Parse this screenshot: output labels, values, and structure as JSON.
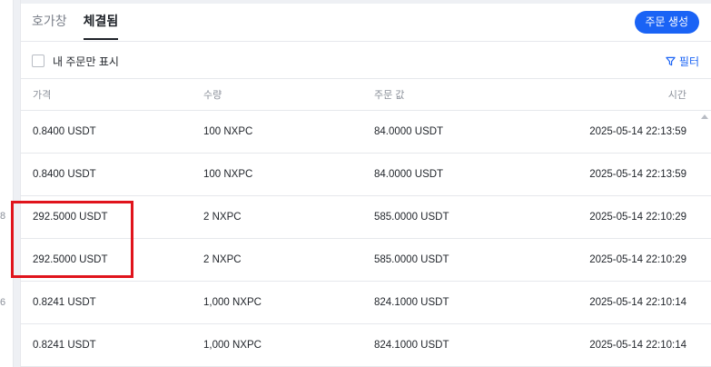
{
  "left_strip": {
    "ghost_numbers": [
      "8",
      "6"
    ]
  },
  "tabs": [
    {
      "label": "호가창",
      "active": false
    },
    {
      "label": "체결됨",
      "active": true
    }
  ],
  "create_order_label": "주문 생성",
  "filter_row": {
    "my_orders_label": "내 주문만 표시",
    "my_orders_checked": false,
    "filter_label": "필터"
  },
  "table": {
    "headers": {
      "price": "가격",
      "quantity": "수량",
      "order_value": "주문 값",
      "time": "시간"
    },
    "rows": [
      {
        "price": "0.8400 USDT",
        "quantity": "100 NXPC",
        "order_value": "84.0000 USDT",
        "time": "2025-05-14 22:13:59"
      },
      {
        "price": "0.8400 USDT",
        "quantity": "100 NXPC",
        "order_value": "84.0000 USDT",
        "time": "2025-05-14 22:13:59"
      },
      {
        "price": "292.5000 USDT",
        "quantity": "2 NXPC",
        "order_value": "585.0000 USDT",
        "time": "2025-05-14 22:10:29"
      },
      {
        "price": "292.5000 USDT",
        "quantity": "2 NXPC",
        "order_value": "585.0000 USDT",
        "time": "2025-05-14 22:10:29"
      },
      {
        "price": "0.8241 USDT",
        "quantity": "1,000 NXPC",
        "order_value": "824.1000 USDT",
        "time": "2025-05-14 22:10:14"
      },
      {
        "price": "0.8241 USDT",
        "quantity": "1,000 NXPC",
        "order_value": "824.1000 USDT",
        "time": "2025-05-14 22:10:14"
      }
    ]
  },
  "colors": {
    "accent": "#1a63f5",
    "highlight": "#e0141c"
  }
}
